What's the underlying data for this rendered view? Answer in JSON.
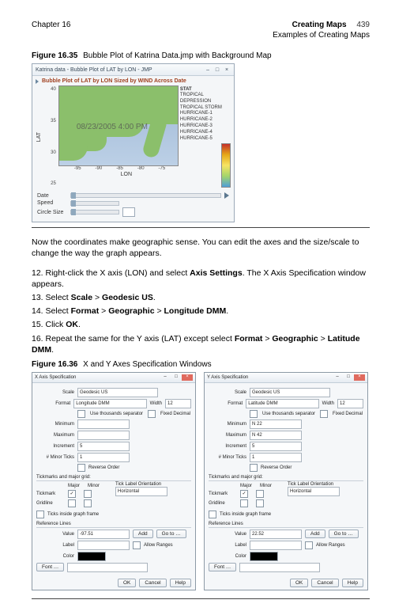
{
  "header": {
    "chapter": "Chapter 16",
    "title": "Creating Maps",
    "subtitle": "Examples of Creating Maps",
    "page_number": "439"
  },
  "figure35": {
    "num": "Figure 16.35",
    "caption": "Bubble Plot of Katrina Data.jmp with Background Map",
    "window_title": "Katrina data - Bubble Plot of LAT by LON - JMP",
    "plot_title": "Bubble Plot of LAT by LON Sized by WIND Across Date",
    "overlay": "08/23/2005 4:00 PM",
    "y_ticks": [
      "40",
      "35",
      "30",
      "25"
    ],
    "x_ticks": [
      "-95",
      "-90",
      "-85",
      "-80",
      "-75"
    ],
    "y_label": "LAT",
    "x_label": "LON",
    "legend_title": "STAT",
    "legend_items": [
      "TROPICAL DEPRESSION",
      "TROPICAL STORM",
      "HURRICANE-1",
      "HURRICANE-2",
      "HURRICANE-3",
      "HURRICANE-4",
      "HURRICANE-5"
    ],
    "controls": {
      "date_label": "Date",
      "speed_label": "Speed",
      "circle_label": "Circle Size"
    },
    "chart_data": {
      "type": "map-bubble",
      "title": "Bubble Plot of LAT by LON Sized by WIND Across Date",
      "xlabel": "LON",
      "ylabel": "LAT",
      "x_range": [
        -95,
        -75
      ],
      "y_range": [
        25,
        40
      ],
      "size_variable": "WIND",
      "time_variable": "Date",
      "current_time": "08/23/2005 4:00 PM",
      "color_variable": "STAT",
      "categories": [
        "TROPICAL DEPRESSION",
        "TROPICAL STORM",
        "HURRICANE-1",
        "HURRICANE-2",
        "HURRICANE-3",
        "HURRICANE-4",
        "HURRICANE-5"
      ]
    }
  },
  "para1": "Now the coordinates make geographic sense. You can edit the axes and the size/scale to change the way the graph appears.",
  "steps": {
    "s12a": "12. Right-click the X axis (LON) and select ",
    "s12b": "Axis Settings",
    "s12c": ". The X Axis Specification window appears.",
    "s13a": "13. Select ",
    "s13b": "Scale",
    "s13c": " > ",
    "s13d": "Geodesic US",
    "s13e": ".",
    "s14a": "14. Select ",
    "s14b": "Format",
    "s14c": " > ",
    "s14d": "Geographic",
    "s14e": " > ",
    "s14f": "Longitude DMM",
    "s14g": ".",
    "s15a": "15. Click ",
    "s15b": "OK",
    "s15c": ".",
    "s16a": "16. Repeat the same for the Y axis (LAT) except select ",
    "s16b": "Format",
    "s16c": " > ",
    "s16d": "Geographic",
    "s16e": " > ",
    "s16f": "Latitude DMM",
    "s16g": "."
  },
  "figure36": {
    "num": "Figure 16.36",
    "caption": "X and Y Axes Specification Windows"
  },
  "dialog_common": {
    "scale_label": "Scale",
    "format_label": "Format",
    "minimum_label": "Minimum",
    "maximum_label": "Maximum",
    "increment_label": "Increment",
    "minor_ticks_label": "# Minor Ticks",
    "scale_value": "Geodesic US",
    "width_label": "Width ",
    "width_value": "12",
    "use_sep": "Use thousands separator",
    "fixed_dec": "Fixed Decimal",
    "reverse_order": "Reverse Order",
    "tick_group": "Tickmarks and major grid:",
    "tick_major": "Major",
    "tick_minor": "Minor",
    "tickmark": "Tickmark",
    "gridline": "Gridline",
    "orientation": "Tick Label Orientation",
    "orientation_value": "Horizontal",
    "inside_ticks": "Ticks inside graph frame",
    "ref_lines": "Reference Lines",
    "value_label": "Value",
    "label_label": "Label",
    "color_label": "Color",
    "add_btn": "Add",
    "go_btn": "Go to …",
    "allow_ranges": "Allow Ranges",
    "font_btn": "Font …",
    "ok_btn": "OK",
    "cancel_btn": "Cancel",
    "help_btn": "Help"
  },
  "dialog_x": {
    "title": "X Axis Specification",
    "format_value": "Longitude DMM",
    "minimum_value": "",
    "maximum_value": "",
    "increment_value": "5",
    "minor_ticks_value": "1",
    "ref_value": "-97.51"
  },
  "dialog_y": {
    "title": "Y Axis Specification",
    "format_value": "Latitude DMM",
    "minimum_value": "N 22",
    "maximum_value": "N 42",
    "increment_value": "5",
    "minor_ticks_value": "1",
    "ref_value": "22.52"
  }
}
